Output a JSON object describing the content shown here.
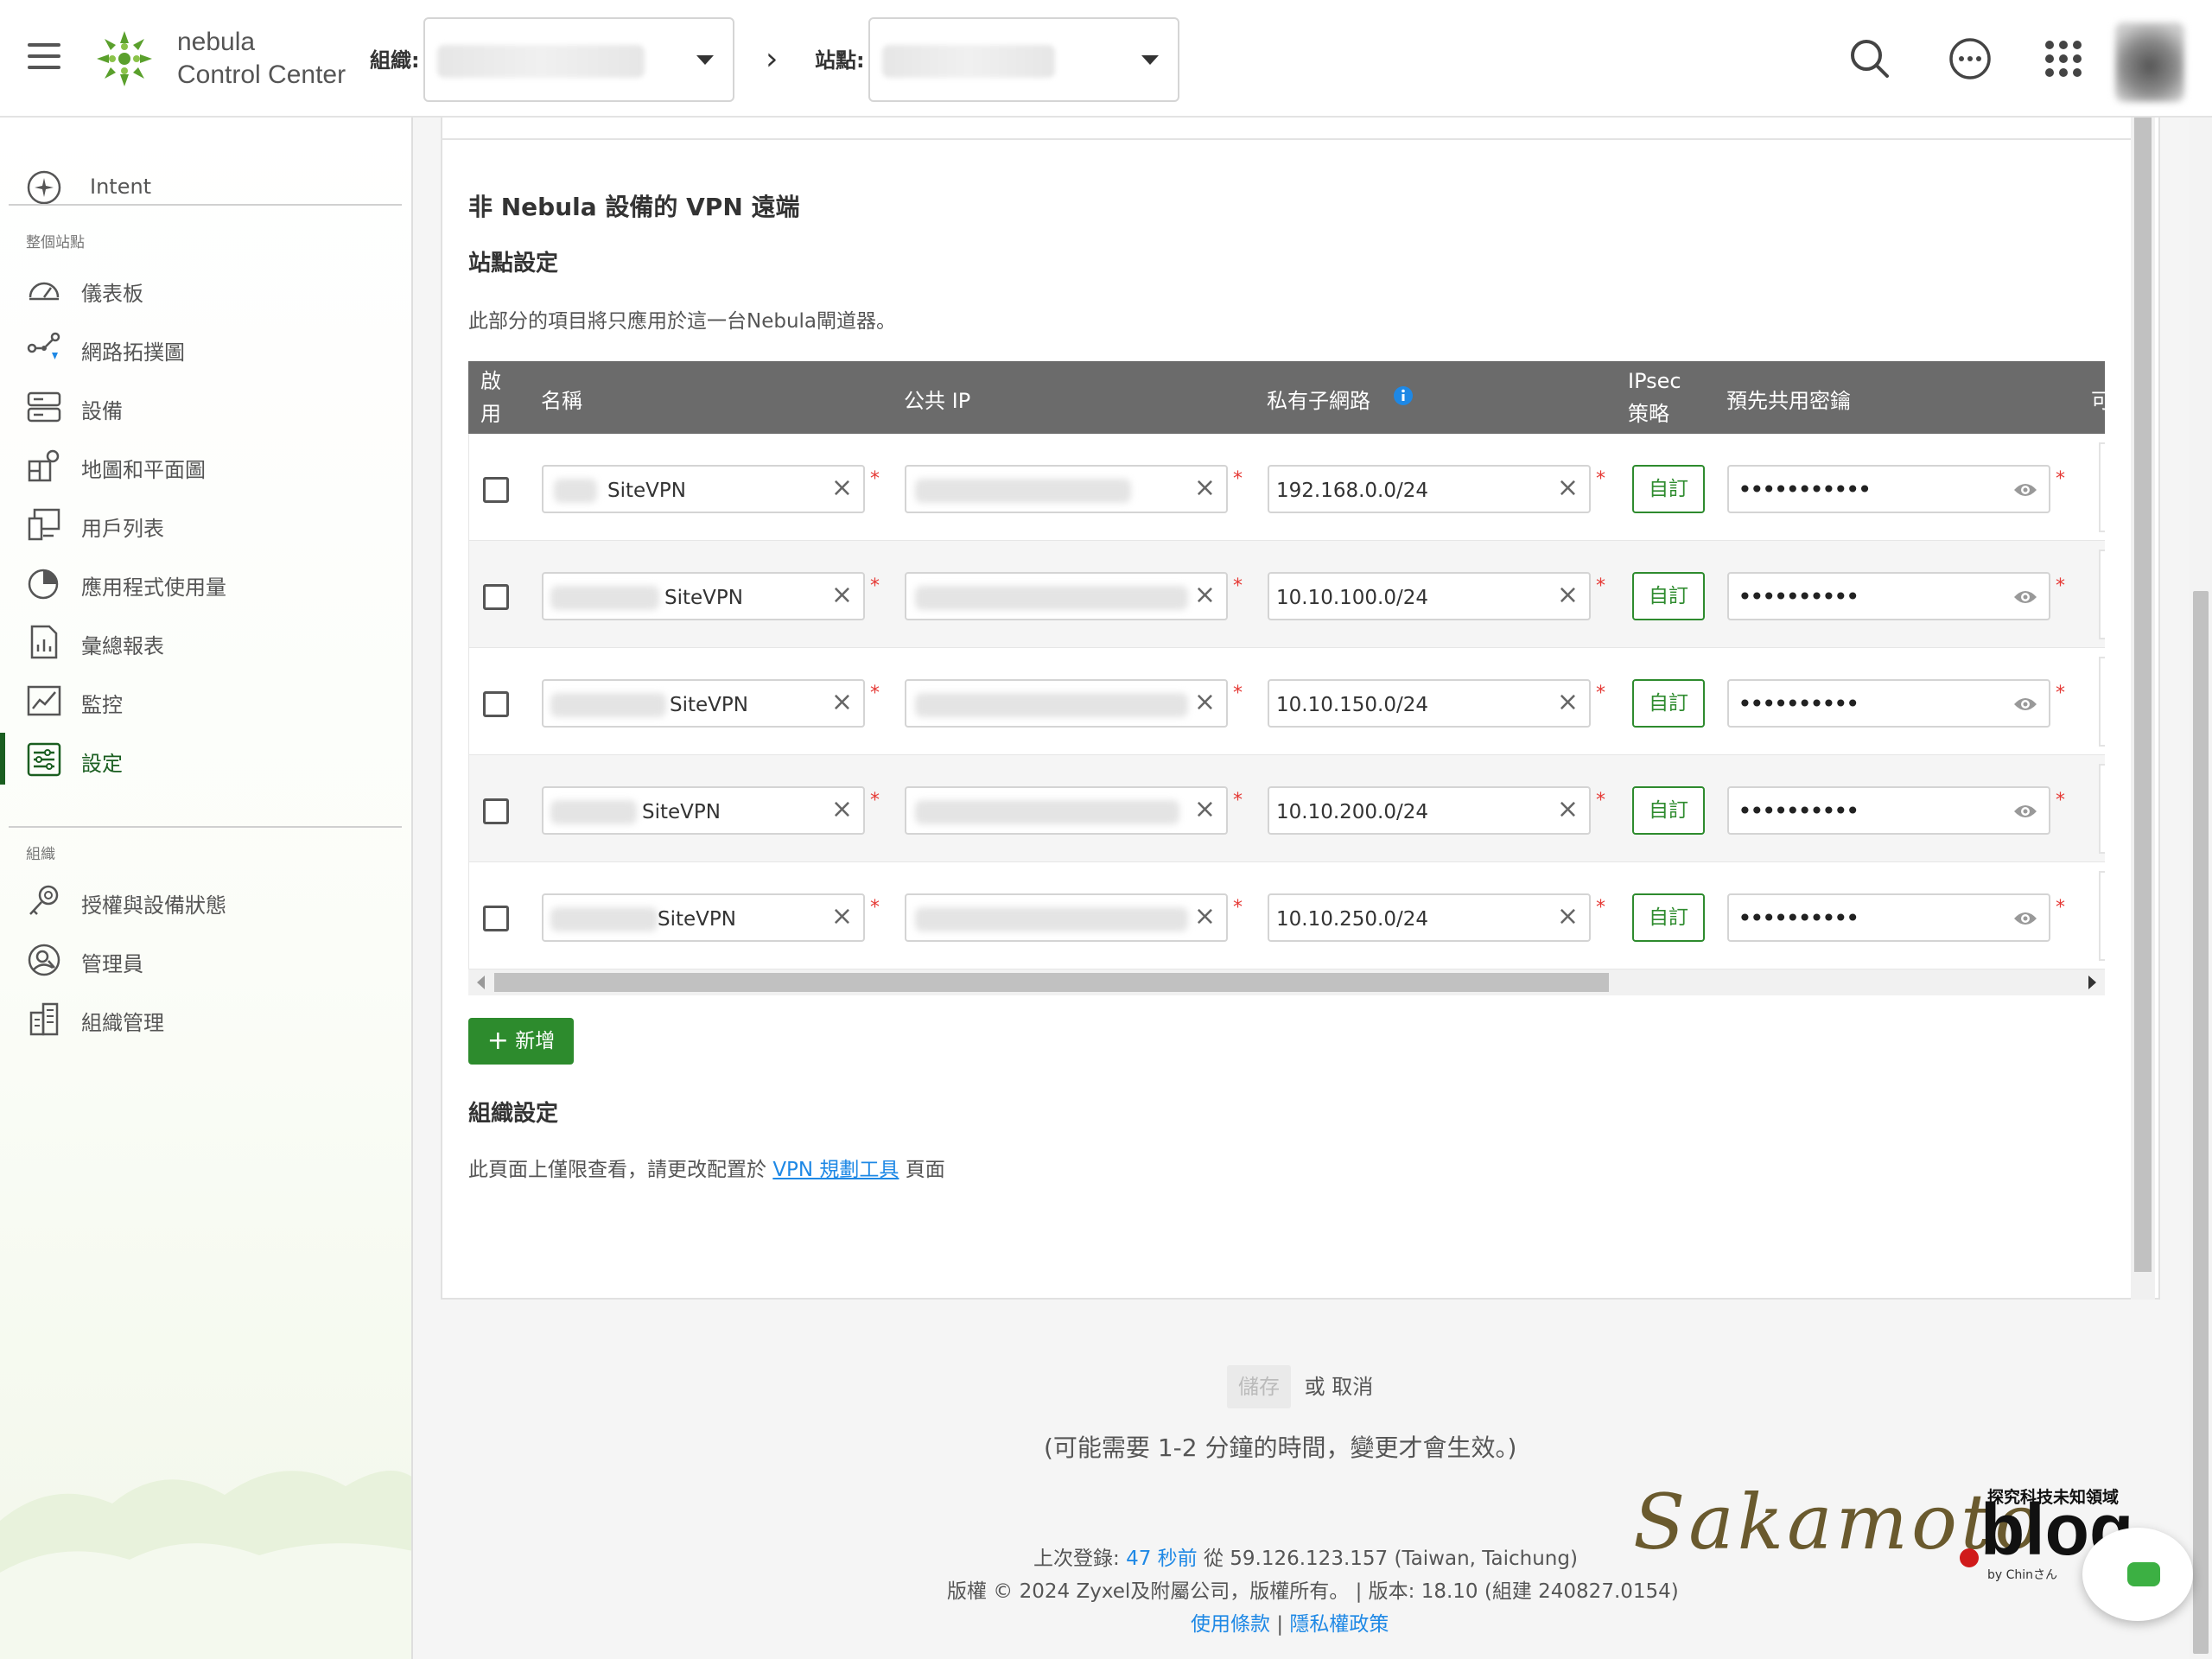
{
  "topbar": {
    "brand_line1": "nebula",
    "brand_line2": "Control Center",
    "org_label": "組織:",
    "site_label": "站點:"
  },
  "icons": {
    "menu": "hamburger-icon",
    "search": "search-icon",
    "more": "more-icon",
    "apps": "apps-grid-icon"
  },
  "sidebar": {
    "intent": "Intent",
    "section_site": "整個站點",
    "items": [
      {
        "label": "儀表板",
        "icon": "dashboard-icon"
      },
      {
        "label": "網路拓撲圖",
        "icon": "topology-icon"
      },
      {
        "label": "設備",
        "icon": "devices-icon"
      },
      {
        "label": "地圖和平面圖",
        "icon": "map-icon"
      },
      {
        "label": "用戶列表",
        "icon": "clients-icon"
      },
      {
        "label": "應用程式使用量",
        "icon": "pie-chart-icon"
      },
      {
        "label": "彙總報表",
        "icon": "report-icon"
      },
      {
        "label": "監控",
        "icon": "monitor-icon"
      },
      {
        "label": "設定",
        "icon": "settings-icon",
        "active": true
      }
    ],
    "section_org": "組織",
    "org_items": [
      {
        "label": "授權與設備狀態",
        "icon": "license-icon"
      },
      {
        "label": "管理員",
        "icon": "admin-icon"
      },
      {
        "label": "組織管理",
        "icon": "building-icon"
      }
    ]
  },
  "main": {
    "title": "非 Nebula 設備的 VPN 遠端",
    "site_settings": "站點設定",
    "description": "此部分的項目將只應用於這一台Nebula閘道器。",
    "columns": {
      "enable_1": "啟",
      "enable_2": "用",
      "name": "名稱",
      "public_ip": "公共 IP",
      "private_subnet": "私有子網路",
      "ipsec_1": "IPsec",
      "ipsec_2": "策略",
      "psk": "預先共用密鑰",
      "more": "可"
    },
    "rows": [
      {
        "name_suffix": "SiteVPN",
        "subnet": "192.168.0.0/24",
        "policy": "自訂",
        "psk": "•••••••••••"
      },
      {
        "name_suffix": "SiteVPN",
        "subnet": "10.10.100.0/24",
        "policy": "自訂",
        "psk": "••••••••••"
      },
      {
        "name_suffix": "SiteVPN",
        "subnet": "10.10.150.0/24",
        "policy": "自訂",
        "psk": "••••••••••"
      },
      {
        "name_suffix": "SiteVPN",
        "subnet": "10.10.200.0/24",
        "policy": "自訂",
        "psk": "••••••••••"
      },
      {
        "name_suffix": "SiteVPN",
        "subnet": "10.10.250.0/24",
        "policy": "自訂",
        "psk": "••••••••••"
      }
    ],
    "add_button": "新增",
    "org_settings": "組織設定",
    "org_note_prefix": "此頁面上僅限查看，請更改配置於",
    "org_note_link": "VPN 規劃工具",
    "org_note_suffix": "頁面"
  },
  "actions": {
    "save": "儲存",
    "or_cancel": "或 取消",
    "notice": "(可能需要 1-2 分鐘的時間，變更才會生效。)"
  },
  "footer": {
    "last_login_label": "上次登錄:",
    "last_login_ago": "47 秒前",
    "last_login_from": "從 59.126.123.157 (Taiwan, Taichung)",
    "copyright": "版權 © 2024 Zyxel及附屬公司，版權所有。 | 版本: 18.10 (組建 240827.0154)",
    "terms": "使用條款",
    "sep": "|",
    "privacy": "隱私權政策"
  },
  "watermark": {
    "script": "Sakamoto",
    "blog": "blog",
    "tagline": "探究科技未知領域",
    "by": "by Chinさん"
  },
  "colors": {
    "accent_green": "#2d8b2d",
    "link_blue": "#1e88e5",
    "header_gray": "#6b6b6b",
    "required_red": "#e53935"
  }
}
